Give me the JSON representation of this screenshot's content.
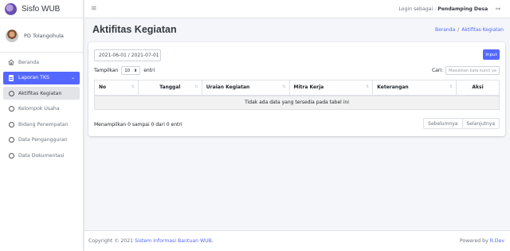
{
  "app": {
    "name": "Sisfo WUB"
  },
  "topbar": {
    "login_prefix": "Login sebagai : ",
    "login_role": "Pendamping Desa",
    "logout_icon": "↦"
  },
  "sidebar": {
    "user": "PD Tolangohula",
    "items": [
      {
        "label": "Beranda",
        "icon": "home-icon"
      },
      {
        "label": "Laporan TKS",
        "icon": "document-icon",
        "caret": "⌄"
      },
      {
        "label": "Aktifitas Kegiatan",
        "icon": "circle-icon"
      },
      {
        "label": "Kelompok Usaha",
        "icon": "circle-icon"
      },
      {
        "label": "Bidang Penempatan",
        "icon": "circle-icon"
      },
      {
        "label": "Data Pengangguran",
        "icon": "circle-icon"
      },
      {
        "label": "Data Dokumentasi",
        "icon": "circle-icon"
      }
    ]
  },
  "header": {
    "title": "Aktifitas Kegiatan",
    "breadcrumb": {
      "home": "Beranda",
      "separator": "/",
      "current": "Aktifitas Kegiatan"
    }
  },
  "card": {
    "date_range": "2021-06-01 / 2021-07-01",
    "input_button": "Input",
    "length_prefix": "Tampilkan",
    "length_value": "10",
    "length_suffix": "entri",
    "search_label": "Cari:",
    "search_placeholder": "Masukkan kata kunci ya",
    "columns": [
      "No",
      "Tanggal",
      "Uraian Kegiatan",
      "Mitra Kerja",
      "Keterangan",
      "Aksi"
    ],
    "empty_text": "Tidak ada data yang tersedia pada tabel ini",
    "info": "Menampilkan 0 sampai 0 dari 0 entri",
    "prev": "Sebelumnya",
    "next": "Selanjutnya"
  },
  "footer": {
    "copyright_prefix": "Copyright © 2021 ",
    "copyright_link": "Sistem Informasi Bantuan WUB.",
    "powered_prefix": "Powered by ",
    "powered_link": "R.Dev"
  },
  "colors": {
    "accent": "#5468ff"
  }
}
